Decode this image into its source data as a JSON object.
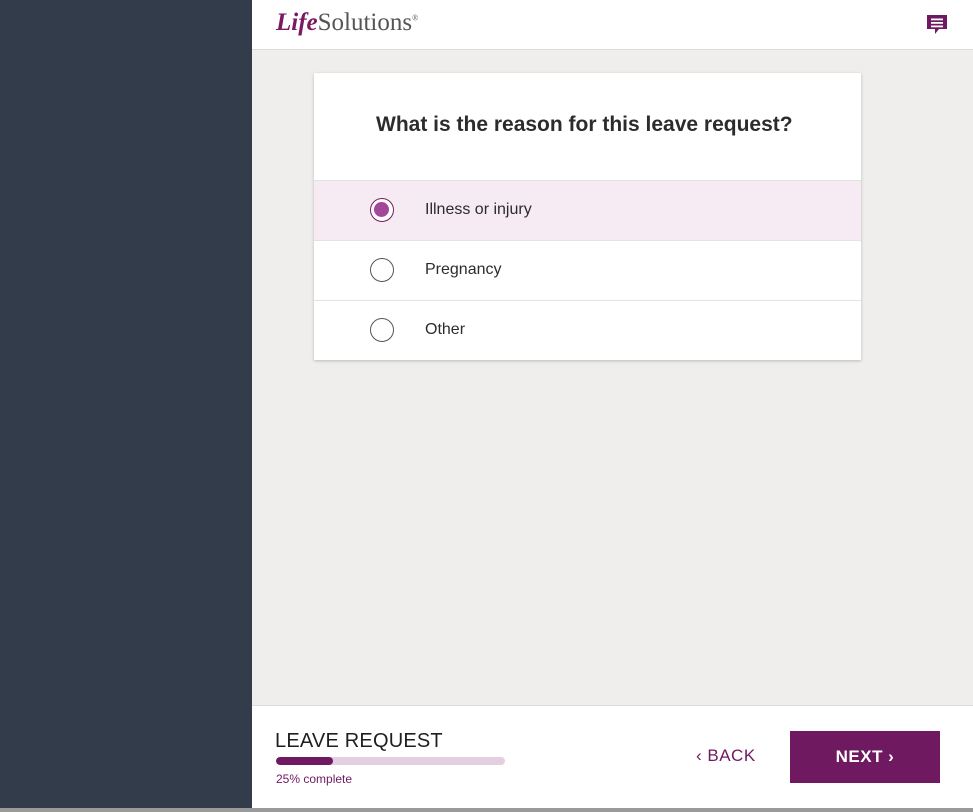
{
  "header": {
    "logo_life": "Life",
    "logo_solutions": "Solutions",
    "logo_reg": "®",
    "chat_icon": "chat-bubble-icon"
  },
  "question": {
    "text": "What is the reason for this leave request?"
  },
  "options": [
    {
      "label": "Illness or injury",
      "selected": true
    },
    {
      "label": "Pregnancy",
      "selected": false
    },
    {
      "label": "Other",
      "selected": false
    }
  ],
  "footer": {
    "title": "LEAVE REQUEST",
    "progress_percent": 25,
    "progress_text": "25% complete",
    "back_label": "‹  BACK",
    "next_label": "NEXT ›"
  },
  "colors": {
    "brand": "#6f1961",
    "radio_fill": "#a3479a",
    "selected_bg": "#f6eaf3",
    "sidebar": "#333c4a",
    "background": "#efeeec"
  }
}
